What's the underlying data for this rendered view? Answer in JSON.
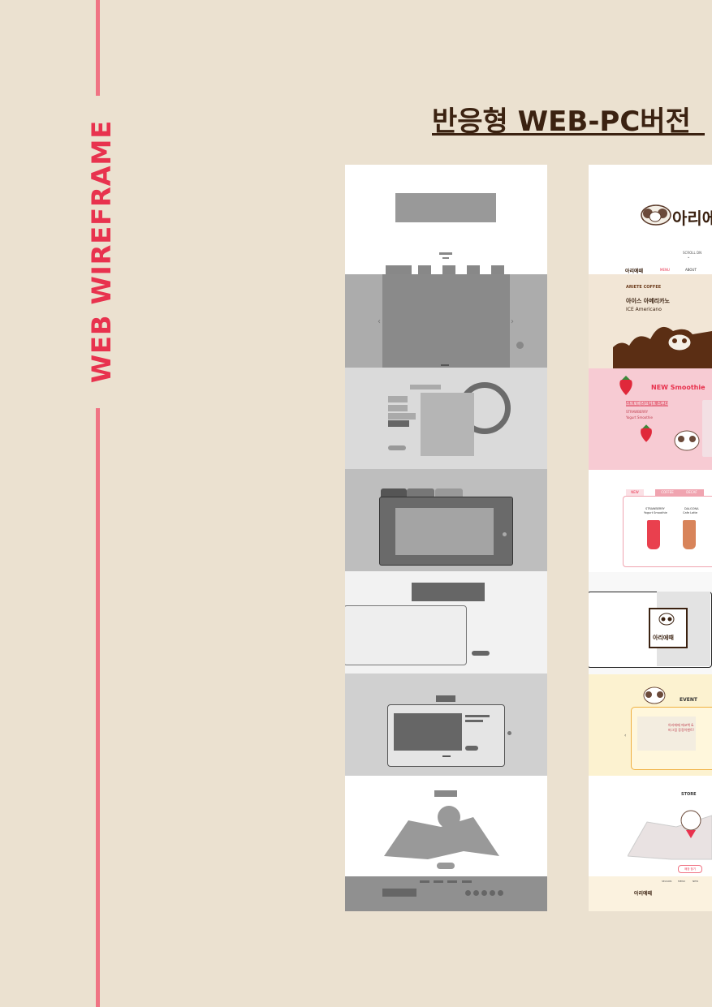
{
  "side_title": "WEB WIREFRAME",
  "main_title": "반응형 WEB-PC버전",
  "design": {
    "logo_text": "아리에",
    "scroll_hint": "SCROLL DN",
    "nav_logo": "아리에때",
    "nav_items": [
      "MENU",
      "ABOUT"
    ],
    "hero_brand": "ARIETE COFFEE",
    "hero_title_ko": "아이스 아메리카노",
    "hero_title_en": "ICE Americano",
    "smoothie_title": "NEW Smoothie",
    "smoothie_sub": "스트로베리요거트 스무디",
    "smoothie_en1": "STRAWBERRY",
    "smoothie_en2": "Yogurt Smoothie",
    "menu_tabs": [
      "NEW",
      "COFFEE",
      "DECAF"
    ],
    "menu_items": [
      {
        "name": "STRAWBERRY",
        "sub": "Yogurt Smoothie"
      },
      {
        "name": "DALGONA",
        "sub": "Cafe Latte"
      }
    ],
    "sign_text": "아리에때",
    "event_title": "EVENT",
    "event_card_text": "아리에때 에코백 & 머그컵 증정이벤트!",
    "store_title": "STORE",
    "store_button": "매장 찾기",
    "footer_logo": "아리에때",
    "footer_links": [
      "SEASON",
      "MENU",
      "NEW"
    ]
  },
  "colors": {
    "background": "#ebe1d0",
    "accent_pink": "#f07484",
    "title_red": "#e8324e",
    "title_brown": "#3b2211"
  }
}
